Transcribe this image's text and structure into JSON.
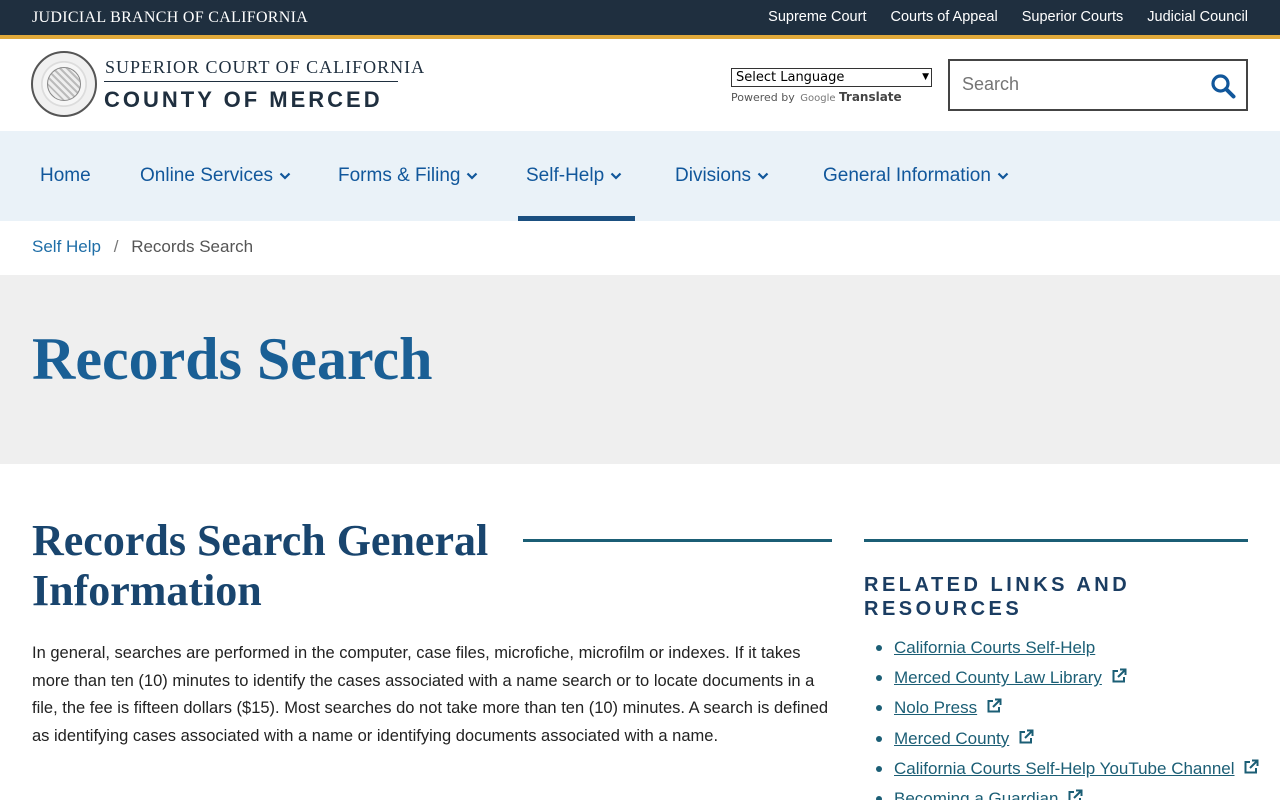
{
  "topbar": {
    "branch_title": "JUDICIAL BRANCH OF CALIFORNIA",
    "links": [
      "Supreme Court",
      "Courts of Appeal",
      "Superior Courts",
      "Judicial Council"
    ]
  },
  "header": {
    "logo_top": "SUPERIOR COURT OF CALIFORNIA",
    "logo_bottom": "COUNTY OF MERCED",
    "language_select": "Select Language",
    "powered_by": "Powered by",
    "google": "Google",
    "translate": "Translate",
    "search_placeholder": "Search"
  },
  "nav": {
    "items": [
      {
        "label": "Home"
      },
      {
        "label": "Online Services"
      },
      {
        "label": "Forms & Filing"
      },
      {
        "label": "Self-Help"
      },
      {
        "label": "Divisions"
      },
      {
        "label": "General Information"
      }
    ]
  },
  "breadcrumb": {
    "parent": "Self Help",
    "separator": "/",
    "current": "Records Search"
  },
  "hero": {
    "title": "Records Search"
  },
  "main": {
    "section_title": "Records Search General Information",
    "body": "In general, searches are performed in the computer, case files, microfiche, microfilm or indexes. If it takes more than ten (10) minutes to identify the cases associated with a name search or to locate documents in a file, the fee is fifteen dollars ($15). Most searches do not take more than ten (10) minutes. A search is defined as identifying cases associated with a name or identifying documents associated with a name."
  },
  "sidebar": {
    "title": "RELATED LINKS AND RESOURCES",
    "links": [
      {
        "label": "California Courts Self-Help"
      },
      {
        "label": "Merced County Law Library"
      },
      {
        "label": "Nolo Press"
      },
      {
        "label": "Merced County"
      },
      {
        "label": "California Courts Self-Help YouTube Channel"
      },
      {
        "label": "Becoming a Guardian"
      }
    ]
  },
  "colors": {
    "topbar_bg": "#1f2f3f",
    "gold_accent": "#e0a93a",
    "nav_bg": "#eaf2f8",
    "link_blue": "#11579b",
    "heading_blue": "#1a5f95",
    "teal_rule": "#1b5e75"
  },
  "icons": {
    "search": "search-icon",
    "dropdown": "chevron-down-icon",
    "external": "external-link-icon"
  }
}
